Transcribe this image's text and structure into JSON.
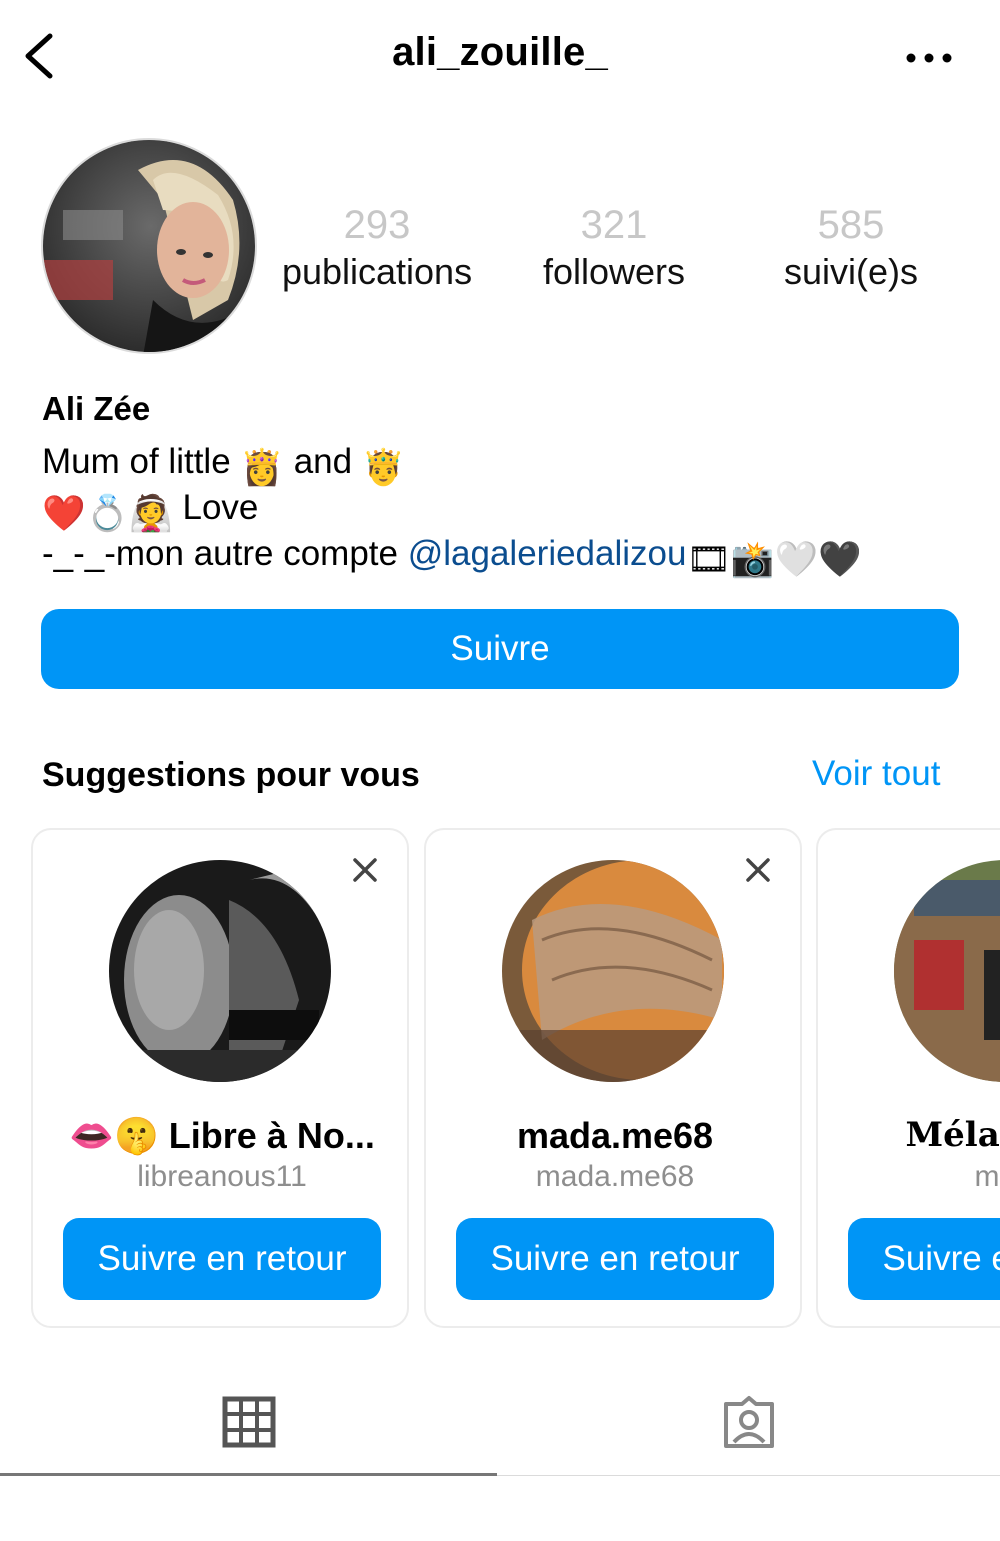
{
  "header": {
    "username": "ali_zouille_"
  },
  "stats": [
    {
      "value": "293",
      "label": "publications"
    },
    {
      "value": "321",
      "label": "followers"
    },
    {
      "value": "585",
      "label": "suivi(e)s"
    }
  ],
  "bio": {
    "name": "Ali Zée",
    "line1_a": "Mum of little ",
    "line1_emoji1": "👸",
    "line1_b": " and ",
    "line1_emoji2": "🤴",
    "line2_emojis": "❤️💍👰",
    "line2_text": " Love",
    "line3_prefix": "-_-_-mon autre compte ",
    "line3_mention": "@lagaleriedalizou",
    "line3_emojis": " 🎞📸🤍🖤"
  },
  "follow_button": "Suivre",
  "suggestions": {
    "title": "Suggestions pour vous",
    "see_all": "Voir tout",
    "cards": [
      {
        "emojis": "👄🤫",
        "name": " Libre à No...",
        "username": "libreanous11",
        "button": "Suivre en retour"
      },
      {
        "name": "mada.me68",
        "username": "mada.me68",
        "button": "Suivre en retour"
      },
      {
        "name": "Mélanie M",
        "username": "mela",
        "button": "Suivre en retour"
      }
    ]
  },
  "colors": {
    "accent": "#0095f6",
    "mention": "#0b4d8f",
    "muted": "#8e8e8e",
    "stat_number": "#c7c7c7"
  },
  "icons": [
    "chevron-left-icon",
    "more-icon",
    "close-icon",
    "grid-icon",
    "tagged-icon"
  ]
}
